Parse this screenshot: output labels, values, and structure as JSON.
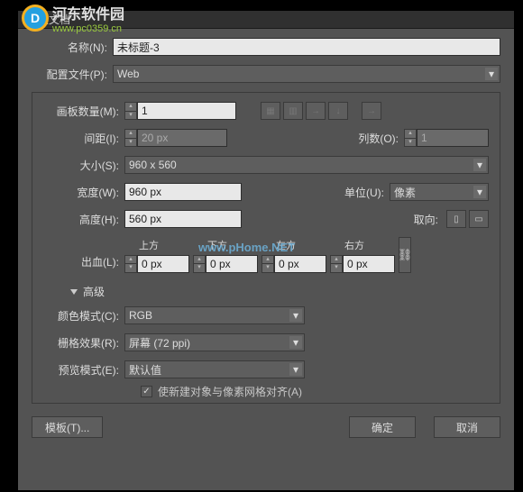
{
  "watermark": {
    "site_name": "河东软件园",
    "site_url": "www.pc0359.cn",
    "center": "www.pHome.NET"
  },
  "dialog": {
    "title": "新建文档",
    "name_label": "名称(N):",
    "name_value": "未标题-3",
    "profile_label": "配置文件(P):",
    "profile_value": "Web",
    "artboard_count_label": "画板数量(M):",
    "artboard_count_value": "1",
    "spacing_label": "间距(I):",
    "spacing_value": "20 px",
    "columns_label": "列数(O):",
    "columns_value": "1",
    "size_label": "大小(S):",
    "size_value": "960 x 560",
    "width_label": "宽度(W):",
    "width_value": "960 px",
    "units_label": "单位(U):",
    "units_value": "像素",
    "height_label": "高度(H):",
    "height_value": "560 px",
    "orientation_label": "取向:",
    "bleed_label": "出血(L):",
    "bleed_top": "上方",
    "bleed_bottom": "下方",
    "bleed_left": "左方",
    "bleed_right": "右方",
    "bleed_value": "0 px",
    "advanced_label": "高级",
    "color_mode_label": "颜色模式(C):",
    "color_mode_value": "RGB",
    "raster_label": "栅格效果(R):",
    "raster_value": "屏幕 (72 ppi)",
    "preview_label": "预览模式(E):",
    "preview_value": "默认值",
    "align_grid_label": "使新建对象与像素网格对齐(A)",
    "template_btn": "模板(T)...",
    "ok_btn": "确定",
    "cancel_btn": "取消"
  }
}
